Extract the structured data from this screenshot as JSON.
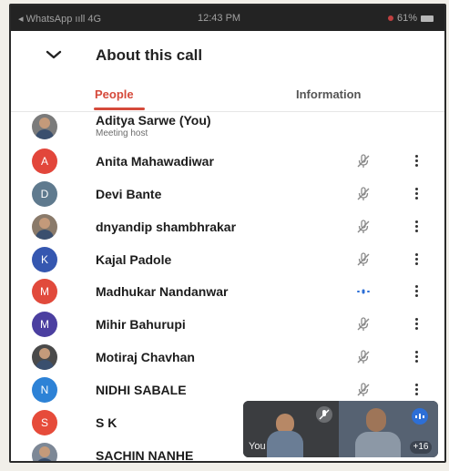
{
  "status_bar": {
    "left": "◂ WhatsApp ııll 4G",
    "time": "12:43 PM",
    "battery": "61%"
  },
  "header": {
    "title": "About this call",
    "back_icon": "chevron-down-icon"
  },
  "tabs": [
    {
      "label": "People",
      "active": true
    },
    {
      "label": "Information",
      "active": false
    }
  ],
  "colors": {
    "accent": "#d54a3b",
    "speaking": "#2d6fd6"
  },
  "participants": [
    {
      "name": "Aditya Sarwe (You)",
      "subtitle": "Meeting host",
      "avatar_text": "",
      "avatar_type": "photo",
      "avatar_color": "#7b7b7b",
      "mic": "none"
    },
    {
      "name": "Anita Mahawadiwar",
      "avatar_text": "A",
      "avatar_type": "letter",
      "avatar_color": "#e2463b",
      "mic": "muted"
    },
    {
      "name": "Devi Bante",
      "avatar_text": "D",
      "avatar_type": "letter",
      "avatar_color": "#5f7a8e",
      "mic": "muted"
    },
    {
      "name": "dnyandip shambhrakar",
      "avatar_text": "",
      "avatar_type": "photo",
      "avatar_color": "#8a7a6a",
      "mic": "muted"
    },
    {
      "name": "Kajal Padole",
      "avatar_text": "K",
      "avatar_type": "letter",
      "avatar_color": "#3557b0",
      "mic": "muted"
    },
    {
      "name": "Madhukar Nandanwar",
      "avatar_text": "M",
      "avatar_type": "letter",
      "avatar_color": "#e14a3c",
      "mic": "speaking"
    },
    {
      "name": "Mihir Bahurupi",
      "avatar_text": "M",
      "avatar_type": "letter",
      "avatar_color": "#4b3fa0",
      "mic": "muted"
    },
    {
      "name": "Motiraj Chavhan",
      "avatar_text": "",
      "avatar_type": "photo",
      "avatar_color": "#4a4a4a",
      "mic": "muted"
    },
    {
      "name": "NIDHI SABALE",
      "avatar_text": "N",
      "avatar_type": "letter",
      "avatar_color": "#2d82d6",
      "mic": "muted"
    },
    {
      "name": "S K",
      "avatar_text": "S",
      "avatar_type": "letter",
      "avatar_color": "#e64b3a",
      "mic": "none"
    },
    {
      "name": "SACHIN NANHE",
      "avatar_text": "",
      "avatar_type": "photo",
      "avatar_color": "#7d8896",
      "mic": "none"
    }
  ],
  "pip": {
    "self_label": "You",
    "overflow_count": "+16"
  }
}
